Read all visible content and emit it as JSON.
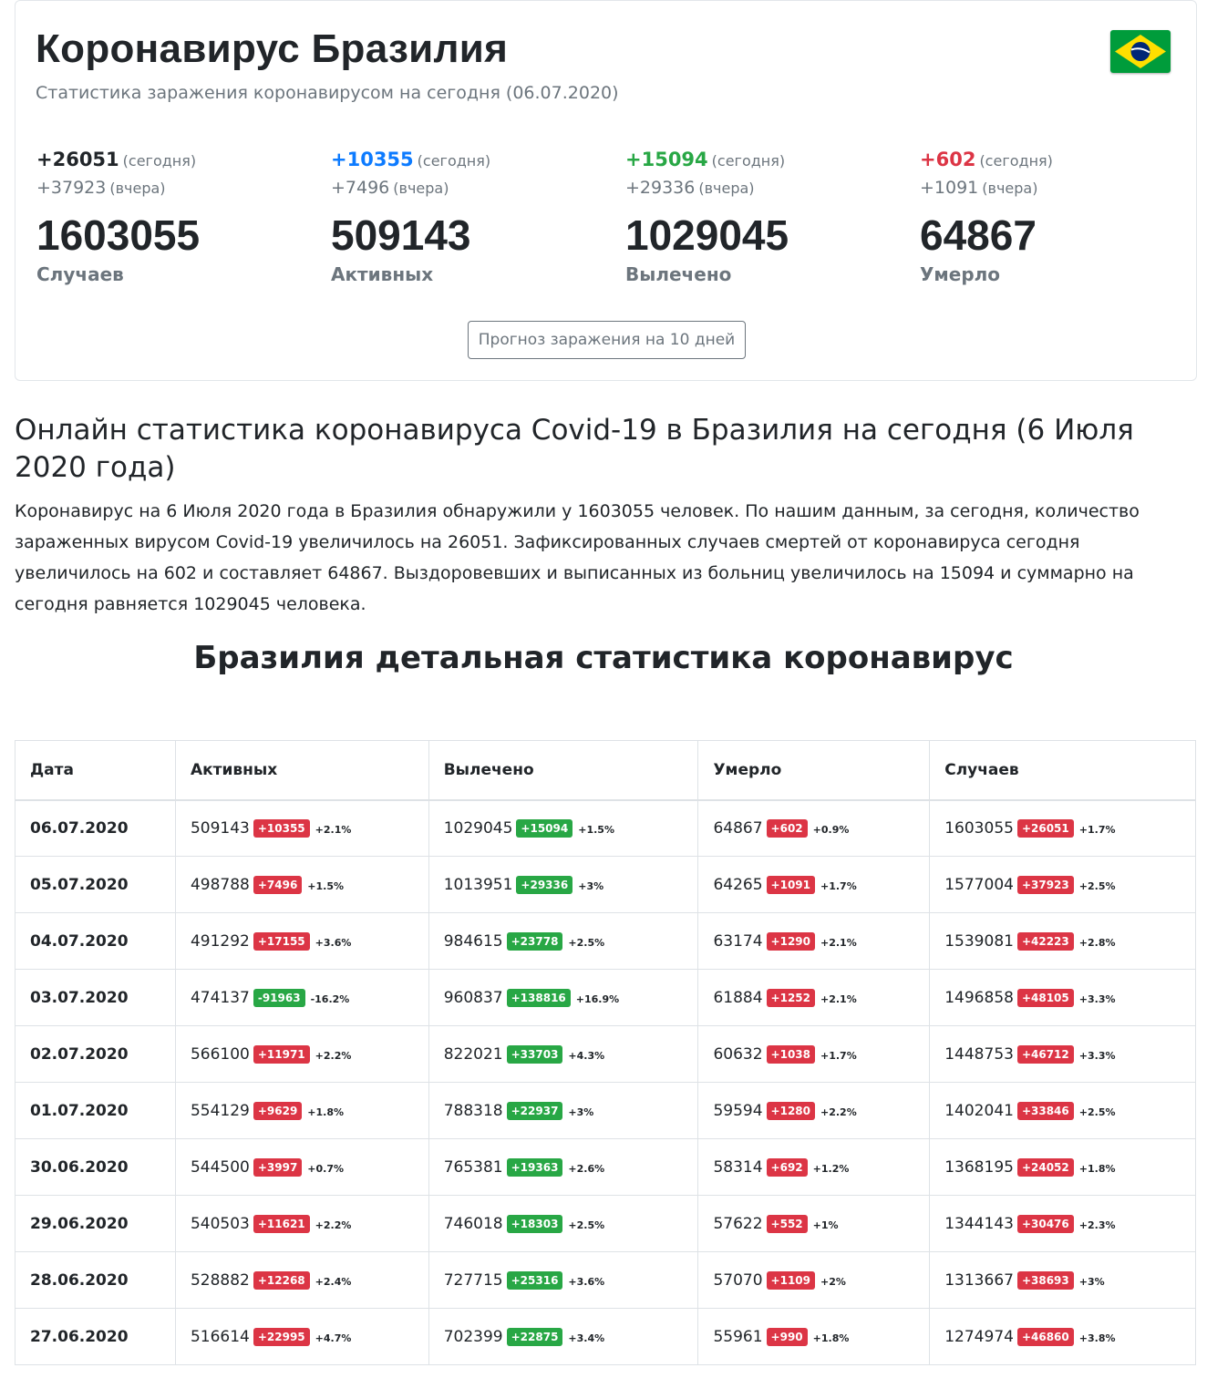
{
  "header": {
    "title": "Коронавирус Бразилия",
    "subtitle": "Статистика заражения коронавирусом на сегодня (06.07.2020)",
    "flag_icon": "brazil-flag-icon"
  },
  "stats": [
    {
      "today": "+26051",
      "today_note": "(сегодня)",
      "yesterday": "+37923",
      "yesterday_note": "(вчера)",
      "total": "1603055",
      "label": "Случаев",
      "color": "#212529"
    },
    {
      "today": "+10355",
      "today_note": "(сегодня)",
      "yesterday": "+7496",
      "yesterday_note": "(вчера)",
      "total": "509143",
      "label": "Активных",
      "color": "#0d7bff"
    },
    {
      "today": "+15094",
      "today_note": "(сегодня)",
      "yesterday": "+29336",
      "yesterday_note": "(вчера)",
      "total": "1029045",
      "label": "Вылечено",
      "color": "#28a745"
    },
    {
      "today": "+602",
      "today_note": "(сегодня)",
      "yesterday": "+1091",
      "yesterday_note": "(вчера)",
      "total": "64867",
      "label": "Умерло",
      "color": "#dc3545"
    }
  ],
  "forecast_button": "Прогноз заражения на 10 дней",
  "section": {
    "heading": "Онлайн статистика коронавируса Covid-19 в Бразилия на сегодня (6 Июля 2020 года)",
    "paragraph": "Коронавирус на 6 Июля 2020 года в Бразилия обнаружили у 1603055 человек. По нашим данным, за сегодня, количество зараженных вирусом Covid-19 увеличилось на 26051. Зафиксированных случаев смертей от коронавируса сегодня увеличилось на 602 и составляет 64867. Выздоровевших и выписанных из больниц увеличилось на 15094 и суммарно на сегодня равняется 1029045 человека."
  },
  "detail_heading": "Бразилия детальная статистика коронавирус",
  "table": {
    "headers": {
      "date": "Дата",
      "active": "Активных",
      "recovered": "Вылечено",
      "deaths": "Умерло",
      "cases": "Случаев"
    },
    "rows": [
      {
        "date": "06.07.2020",
        "active": [
          "509143",
          "+10355",
          "+2.1%"
        ],
        "recovered": [
          "1029045",
          "+15094",
          "+1.5%"
        ],
        "deaths": [
          "64867",
          "+602",
          "+0.9%"
        ],
        "cases": [
          "1603055",
          "+26051",
          "+1.7%"
        ]
      },
      {
        "date": "05.07.2020",
        "active": [
          "498788",
          "+7496",
          "+1.5%"
        ],
        "recovered": [
          "1013951",
          "+29336",
          "+3%"
        ],
        "deaths": [
          "64265",
          "+1091",
          "+1.7%"
        ],
        "cases": [
          "1577004",
          "+37923",
          "+2.5%"
        ]
      },
      {
        "date": "04.07.2020",
        "active": [
          "491292",
          "+17155",
          "+3.6%"
        ],
        "recovered": [
          "984615",
          "+23778",
          "+2.5%"
        ],
        "deaths": [
          "63174",
          "+1290",
          "+2.1%"
        ],
        "cases": [
          "1539081",
          "+42223",
          "+2.8%"
        ]
      },
      {
        "date": "03.07.2020",
        "active": [
          "474137",
          "-91963",
          "-16.2%"
        ],
        "recovered": [
          "960837",
          "+138816",
          "+16.9%"
        ],
        "deaths": [
          "61884",
          "+1252",
          "+2.1%"
        ],
        "cases": [
          "1496858",
          "+48105",
          "+3.3%"
        ]
      },
      {
        "date": "02.07.2020",
        "active": [
          "566100",
          "+11971",
          "+2.2%"
        ],
        "recovered": [
          "822021",
          "+33703",
          "+4.3%"
        ],
        "deaths": [
          "60632",
          "+1038",
          "+1.7%"
        ],
        "cases": [
          "1448753",
          "+46712",
          "+3.3%"
        ]
      },
      {
        "date": "01.07.2020",
        "active": [
          "554129",
          "+9629",
          "+1.8%"
        ],
        "recovered": [
          "788318",
          "+22937",
          "+3%"
        ],
        "deaths": [
          "59594",
          "+1280",
          "+2.2%"
        ],
        "cases": [
          "1402041",
          "+33846",
          "+2.5%"
        ]
      },
      {
        "date": "30.06.2020",
        "active": [
          "544500",
          "+3997",
          "+0.7%"
        ],
        "recovered": [
          "765381",
          "+19363",
          "+2.6%"
        ],
        "deaths": [
          "58314",
          "+692",
          "+1.2%"
        ],
        "cases": [
          "1368195",
          "+24052",
          "+1.8%"
        ]
      },
      {
        "date": "29.06.2020",
        "active": [
          "540503",
          "+11621",
          "+2.2%"
        ],
        "recovered": [
          "746018",
          "+18303",
          "+2.5%"
        ],
        "deaths": [
          "57622",
          "+552",
          "+1%"
        ],
        "cases": [
          "1344143",
          "+30476",
          "+2.3%"
        ]
      },
      {
        "date": "28.06.2020",
        "active": [
          "528882",
          "+12268",
          "+2.4%"
        ],
        "recovered": [
          "727715",
          "+25316",
          "+3.6%"
        ],
        "deaths": [
          "57070",
          "+1109",
          "+2%"
        ],
        "cases": [
          "1313667",
          "+38693",
          "+3%"
        ]
      },
      {
        "date": "27.06.2020",
        "active": [
          "516614",
          "+22995",
          "+4.7%"
        ],
        "recovered": [
          "702399",
          "+22875",
          "+3.4%"
        ],
        "deaths": [
          "55961",
          "+990",
          "+1.8%"
        ],
        "cases": [
          "1274974",
          "+46860",
          "+3.8%"
        ]
      }
    ]
  }
}
